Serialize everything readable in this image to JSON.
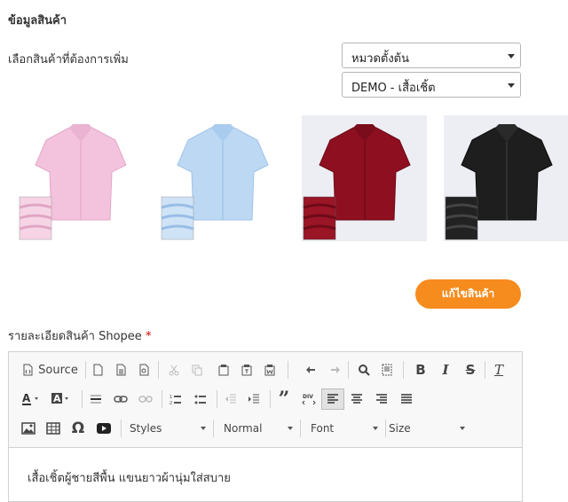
{
  "section": {
    "title": "ข้อมูลสินค้า"
  },
  "selector": {
    "label": "เลือกสินค้าที่ต้องการเพิ่ม",
    "category_value": "หมวดตั้งต้น",
    "product_value": "DEMO - เสื้อเชิ้ต"
  },
  "products": [
    {
      "name": "pink-shirt",
      "color": "#f3c2dc",
      "shade": "#e6a9c9"
    },
    {
      "name": "light-blue-shirt",
      "color": "#bcd8f3",
      "shade": "#9fc3e8"
    },
    {
      "name": "maroon-shirt",
      "color": "#8e1020",
      "shade": "#6d0a17"
    },
    {
      "name": "black-shirt",
      "color": "#1e1e1e",
      "shade": "#0c0c0c"
    }
  ],
  "actions": {
    "edit_label": "แก้ไขสินค้า"
  },
  "description": {
    "label": "รายละเอียดสินค้า Shopee",
    "required_mark": "*",
    "content": "เสื้อเชิ้ตผู้ชายสีพื้น แขนยาวผ้านุ่มใส่สบาย"
  },
  "editor": {
    "source_label": "Source",
    "styles_label": "Styles",
    "format_label": "Normal",
    "font_label": "Font",
    "size_label": "Size",
    "bold": "B",
    "italic": "I",
    "strike": "S",
    "clear": "T",
    "omega": "Ω",
    "quote": "”"
  },
  "colors": {
    "accent": "#f68b1e",
    "required": "#cc0000"
  }
}
